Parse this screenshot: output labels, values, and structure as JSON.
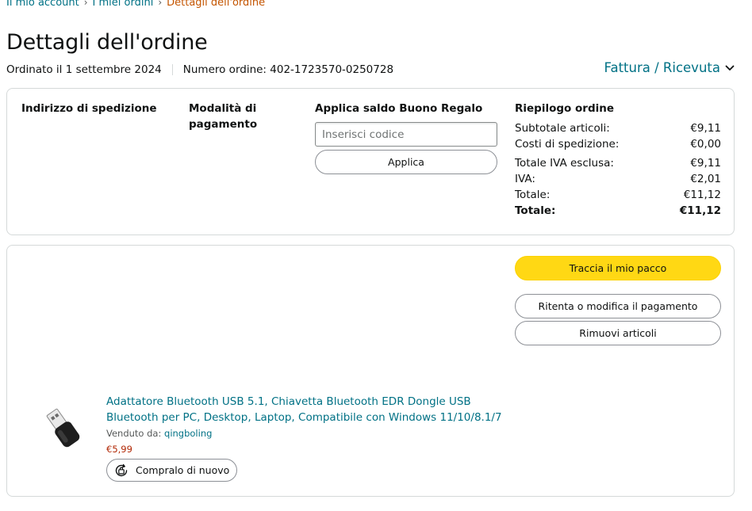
{
  "breadcrumb": {
    "items": [
      "Il mio account",
      "I miei ordini"
    ],
    "separator": "›",
    "current": "Dettagli dell'ordine"
  },
  "page": {
    "title": "Dettagli dell'ordine",
    "ordered_on": "Ordinato il 1 settembre 2024",
    "order_number": "Numero ordine: 402-1723570-0250728",
    "invoice_link": "Fattura / Ricevuta"
  },
  "details": {
    "shipping_address_heading": "Indirizzo di spedizione",
    "payment_method_heading": "Modalità di pagamento",
    "gift_card": {
      "heading": "Applica saldo Buono Regalo",
      "placeholder": "Inserisci codice",
      "value": "",
      "apply_label": "Applica"
    },
    "summary": {
      "heading": "Riepilogo ordine",
      "rows": [
        {
          "label": "Subtotale articoli:",
          "value": "€9,11"
        },
        {
          "label": "Costi di spedizione:",
          "value": "€0,00"
        },
        {
          "label": "Totale IVA esclusa:",
          "value": "€9,11"
        },
        {
          "label": "IVA:",
          "value": "€2,01"
        },
        {
          "label": "Totale:",
          "value": "€11,12"
        },
        {
          "label": "Totale:",
          "value": "€11,12"
        }
      ]
    }
  },
  "actions": {
    "track": "Traccia il mio pacco",
    "retry_payment": "Ritenta o modifica il pagamento",
    "remove_items": "Rimuovi articoli"
  },
  "item": {
    "title_line1": "Adattatore Bluetooth USB 5.1, Chiavetta Bluetooth EDR Dongle USB",
    "title_line2": "Bluetooth per PC, Desktop, Laptop, Compatibile con Windows 11/10/8.1/7",
    "seller_label": "Venduto da:",
    "seller_name": "qingboling",
    "price": "€5,99",
    "buy_again": "Compralo di nuovo",
    "image_icon": "usb-dongle-icon"
  },
  "colors": {
    "link": "#007185",
    "current_crumb": "#c45500",
    "price": "#b12704",
    "primary_button": "#ffd814",
    "border": "#d5d9d9"
  }
}
